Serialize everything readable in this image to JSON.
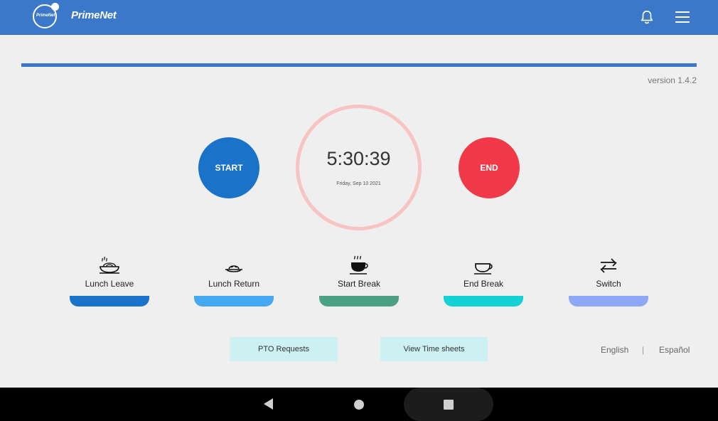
{
  "header": {
    "brand": "PrimeNet",
    "logo_text": "PrimeNet",
    "bg_color": "#3b78c9"
  },
  "version": "version 1.4.2",
  "timer": {
    "start_label": "START",
    "end_label": "END",
    "time": "5:30:39",
    "date": "Friday, Sep 10 2021"
  },
  "actions": [
    {
      "label": "Lunch Leave",
      "icon": "noodle-bowl-icon",
      "color": "#1a73c8"
    },
    {
      "label": "Lunch Return",
      "icon": "food-plate-icon",
      "color": "#44a8f2"
    },
    {
      "label": "Start Break",
      "icon": "hot-coffee-icon",
      "color": "#4aa184"
    },
    {
      "label": "End Break",
      "icon": "empty-cup-icon",
      "color": "#14d2d4"
    },
    {
      "label": "Switch",
      "icon": "swap-arrows-icon",
      "color": "#8ea8f7"
    }
  ],
  "links": {
    "pto": "PTO Requests",
    "timesheets": "View Time sheets"
  },
  "language": {
    "english": "English",
    "separator": "|",
    "spanish": "Español"
  }
}
